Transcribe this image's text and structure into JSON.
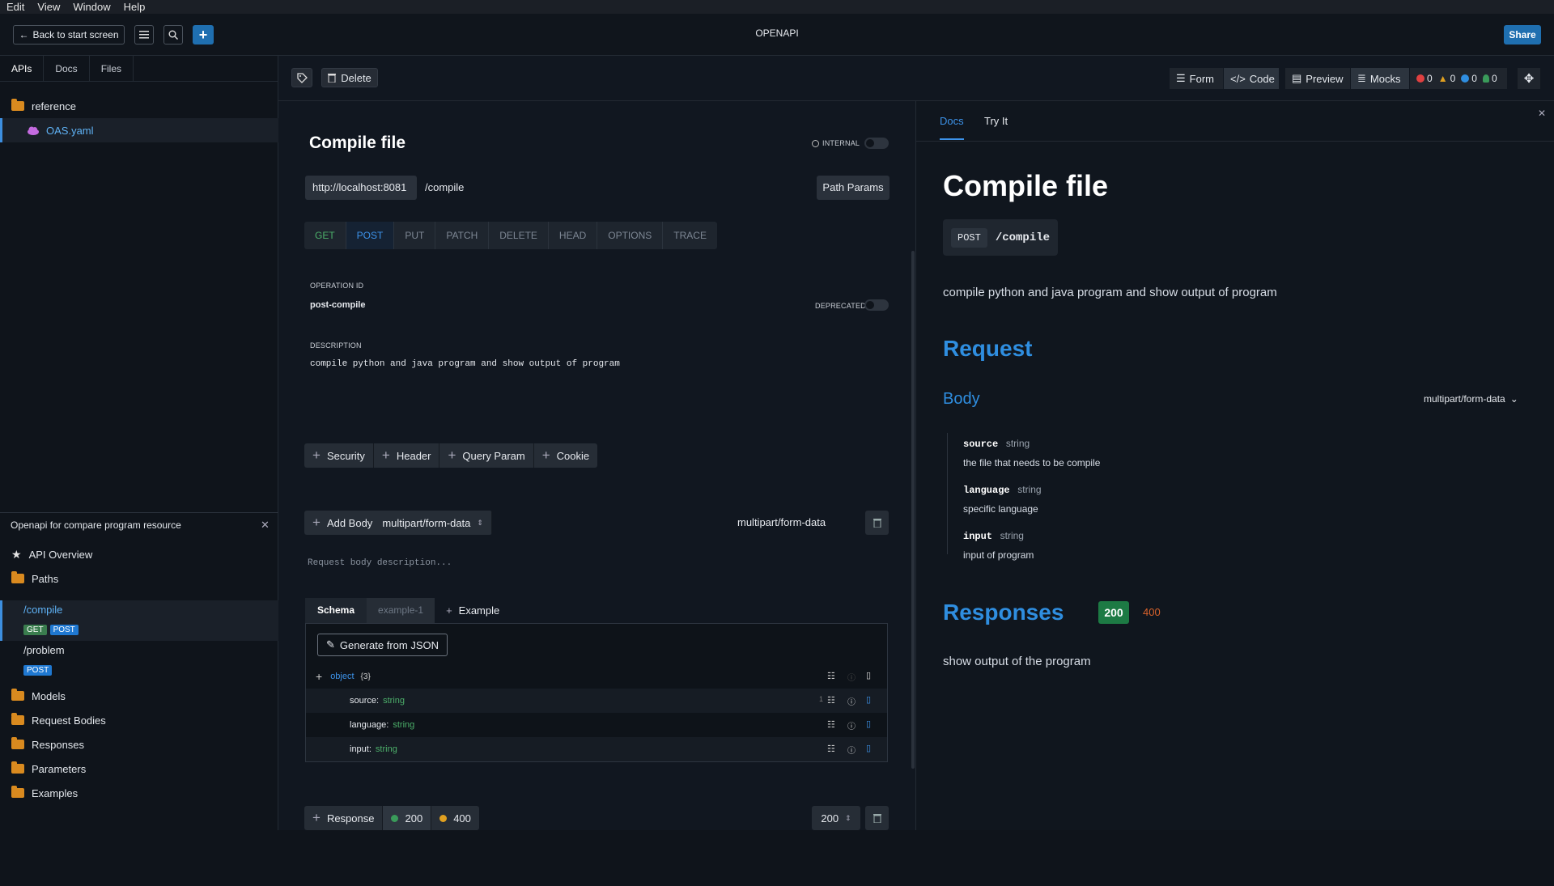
{
  "menu": [
    "Edit",
    "View",
    "Window",
    "Help"
  ],
  "header": {
    "back_label": "Back to start screen",
    "title": "OPENAPI",
    "share_label": "Share"
  },
  "sidebar": {
    "tabs": [
      "APIs",
      "Docs",
      "Files"
    ],
    "tree": {
      "folder": "reference",
      "file": "OAS.yaml"
    },
    "project_title": "Openapi for compare program resource",
    "nav": {
      "overview": "API Overview",
      "paths": "Paths",
      "path_items": [
        {
          "path": "/compile",
          "methods": [
            "GET",
            "POST"
          ]
        },
        {
          "path": "/problem",
          "methods": [
            "POST"
          ]
        }
      ],
      "models": "Models",
      "request_bodies": "Request Bodies",
      "responses": "Responses",
      "parameters": "Parameters",
      "examples": "Examples"
    }
  },
  "toolbar": {
    "delete_label": "Delete",
    "form_label": "Form",
    "code_label": "Code",
    "preview_label": "Preview",
    "mocks_label": "Mocks",
    "counts": {
      "errors": "0",
      "warnings": "0",
      "info": "0",
      "hints": "0"
    }
  },
  "editor": {
    "title": "Compile file",
    "internal_label": "INTERNAL",
    "server": "http://localhost:8081",
    "path": "/compile",
    "path_params_label": "Path Params",
    "methods": [
      "GET",
      "POST",
      "PUT",
      "PATCH",
      "DELETE",
      "HEAD",
      "OPTIONS",
      "TRACE"
    ],
    "operation_id_label": "OPERATION ID",
    "operation_id": "post-compile",
    "deprecated_label": "DEPRECATED",
    "description_label": "DESCRIPTION",
    "description": "compile python and java program and show output of program",
    "param_buttons": [
      "Security",
      "Header",
      "Query Param",
      "Cookie"
    ],
    "add_body_label": "Add Body",
    "body_content_type": "multipart/form-data",
    "body_content_type_right": "multipart/form-data",
    "body_description_placeholder": "Request body description...",
    "schema_tabs": {
      "schema": "Schema",
      "example1": "example-1",
      "add_example": "Example"
    },
    "generate_label": "Generate from JSON",
    "schema_root": {
      "type": "object",
      "count": "{3}"
    },
    "properties": [
      {
        "name": "source",
        "type": "string",
        "badge": "1"
      },
      {
        "name": "language",
        "type": "string",
        "badge": ""
      },
      {
        "name": "input",
        "type": "string",
        "badge": ""
      }
    ],
    "response_label": "Response",
    "response_codes": [
      "200",
      "400"
    ],
    "response_selected": "200"
  },
  "docs": {
    "tabs": [
      "Docs",
      "Try It"
    ],
    "title": "Compile file",
    "method": "POST",
    "path": "/compile",
    "description": "compile python and java program and show output of program",
    "request_heading": "Request",
    "body_heading": "Body",
    "content_type": "multipart/form-data",
    "fields": [
      {
        "name": "source",
        "type": "string",
        "desc": "the file that needs to be compile"
      },
      {
        "name": "language",
        "type": "string",
        "desc": "specific language"
      },
      {
        "name": "input",
        "type": "string",
        "desc": "input of program"
      }
    ],
    "responses_heading": "Responses",
    "codes": [
      "200",
      "400"
    ],
    "response_desc": "show output of the program"
  },
  "colors": {
    "accent": "#2f8ee0",
    "get": "#3a9b5a",
    "post": "#1f78d1",
    "warn": "#e0a020",
    "error": "#e04040"
  }
}
